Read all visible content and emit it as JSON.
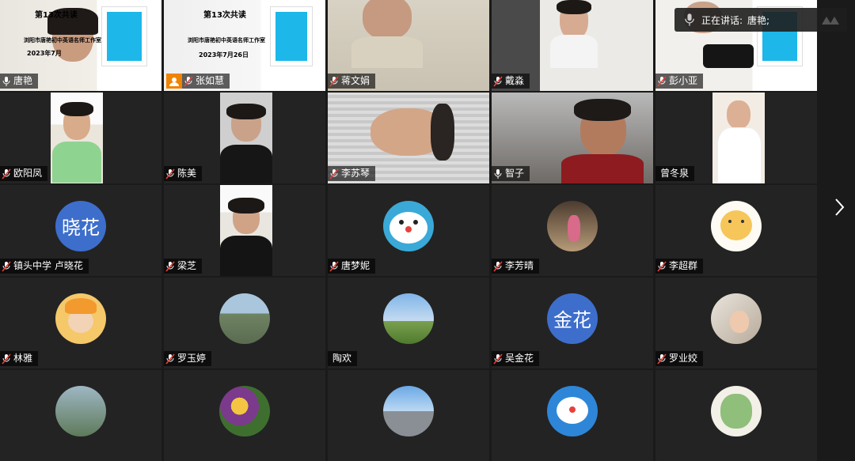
{
  "speaking_indicator": {
    "label": "正在讲话:",
    "name": "唐艳;"
  },
  "slide": {
    "title": "第13次共读",
    "org": "浏阳市唐艳初中英语名师工作室",
    "date1": "2023年7月",
    "date2": "2023年7月26日"
  },
  "participants": [
    {
      "name": "唐艳"
    },
    {
      "name": "张如慧"
    },
    {
      "name": "蒋文娟"
    },
    {
      "name": "戴淼"
    },
    {
      "name": "彭小亚"
    },
    {
      "name": "欧阳凤"
    },
    {
      "name": "陈美"
    },
    {
      "name": "李苏琴"
    },
    {
      "name": "智子"
    },
    {
      "name": "曾冬泉"
    },
    {
      "name": "镇头中学 卢晓花",
      "avatar_text": "晓花"
    },
    {
      "name": "梁芝"
    },
    {
      "name": "唐梦妮"
    },
    {
      "name": "李芳晴"
    },
    {
      "name": "李超群"
    },
    {
      "name": "林雅"
    },
    {
      "name": "罗玉婷"
    },
    {
      "name": "陶欢"
    },
    {
      "name": "吴金花",
      "avatar_text": "金花"
    },
    {
      "name": "罗业姣"
    }
  ],
  "icons": {
    "mic": "mic-muted-icon",
    "host": "host-person-icon",
    "next": "chevron-right-icon"
  },
  "colors": {
    "active_speaker_border": "#23c343",
    "host_badge": "#f08300",
    "avatar_bg": "#3d6ecc"
  }
}
